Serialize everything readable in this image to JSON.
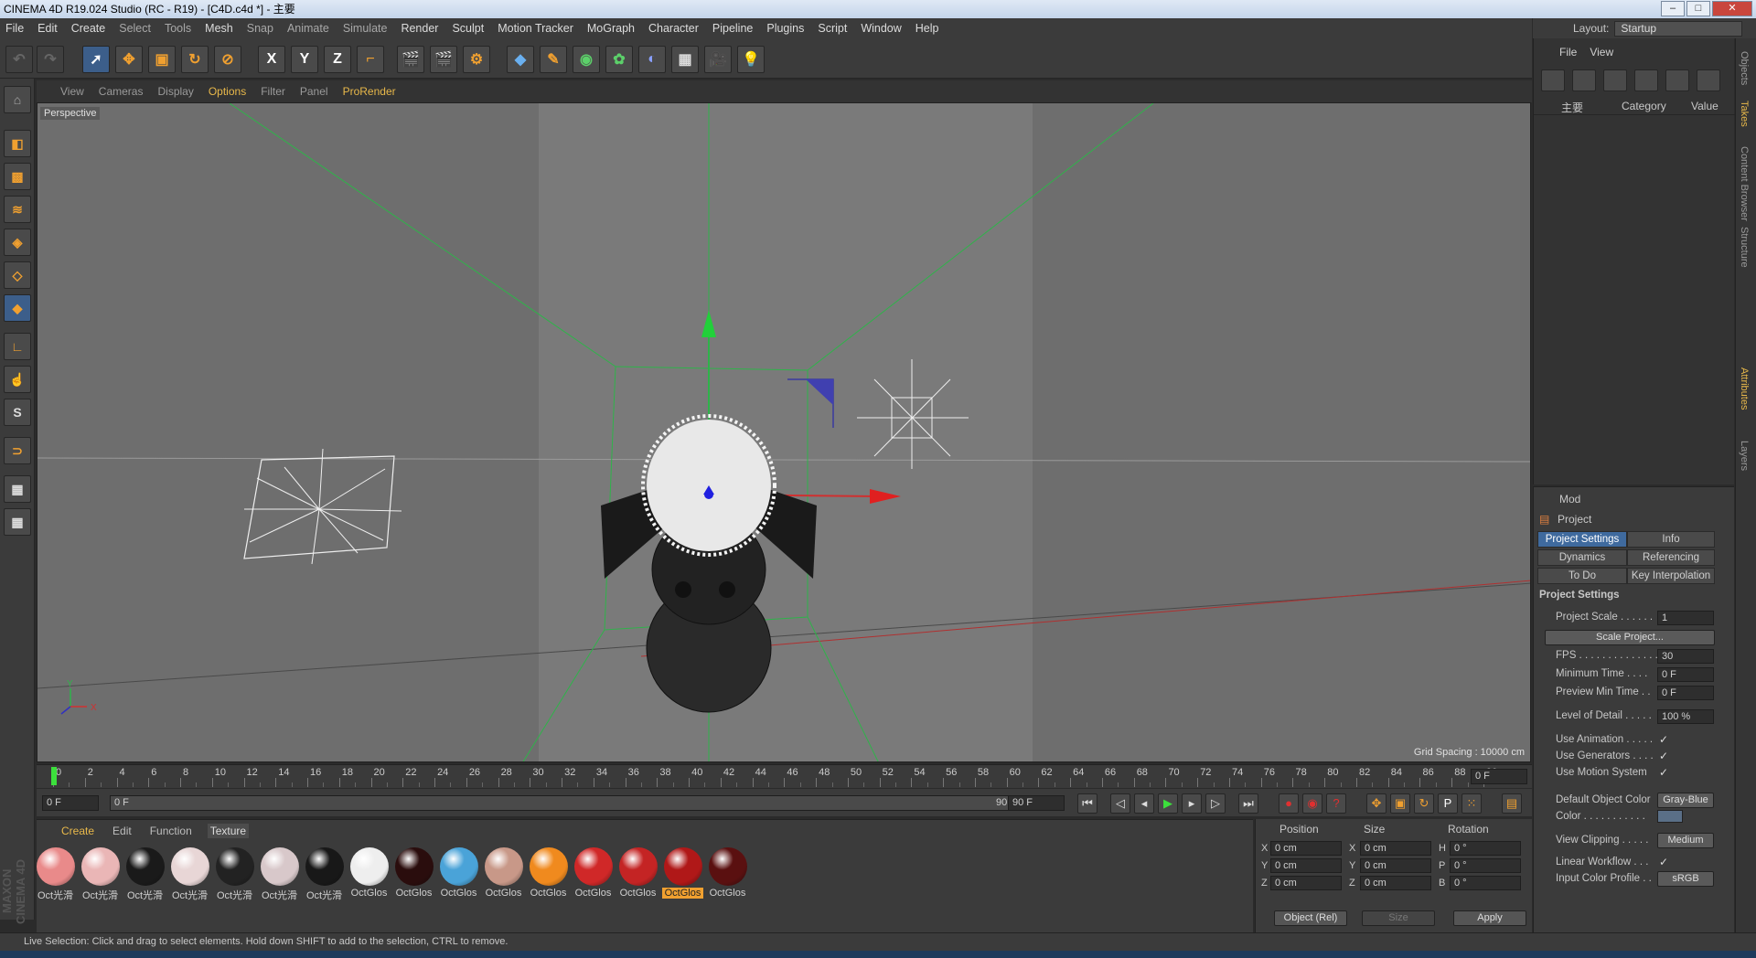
{
  "window": {
    "title": "CINEMA 4D R19.024 Studio (RC - R19) - [C4D.c4d *] - 主要"
  },
  "menubar": {
    "items": [
      "File",
      "Edit",
      "Create",
      "Select",
      "Tools",
      "Mesh",
      "Snap",
      "Animate",
      "Simulate",
      "Render",
      "Sculpt",
      "Motion Tracker",
      "MoGraph",
      "Character",
      "Pipeline",
      "Plugins",
      "Script",
      "Window",
      "Help"
    ]
  },
  "layout": {
    "label": "Layout:",
    "value": "Startup"
  },
  "viewport": {
    "menu": [
      "View",
      "Cameras",
      "Display",
      "Options",
      "Filter",
      "Panel",
      "ProRender"
    ],
    "camera_label": "Perspective",
    "grid_spacing": "Grid Spacing : 10000 cm",
    "axis_y": "Y",
    "axis_x": "X"
  },
  "timeline": {
    "ticks": [
      "0",
      "2",
      "4",
      "6",
      "8",
      "10",
      "12",
      "14",
      "16",
      "18",
      "20",
      "22",
      "24",
      "26",
      "28",
      "30",
      "32",
      "34",
      "36",
      "38",
      "40",
      "42",
      "44",
      "46",
      "48",
      "50",
      "52",
      "54",
      "56",
      "58",
      "60",
      "62",
      "64",
      "66",
      "68",
      "70",
      "72",
      "74",
      "76",
      "78",
      "80",
      "82",
      "84",
      "86",
      "88",
      "90"
    ],
    "current_frame": "0 F",
    "start": "0 F",
    "range_start": "0 F",
    "range_end": "90 F",
    "end": "90 F"
  },
  "materials": {
    "tabs": [
      "Create",
      "Edit",
      "Function",
      "Texture"
    ],
    "items": [
      {
        "label": "Oct光滑",
        "color": "#e98a8a"
      },
      {
        "label": "Oct光滑",
        "color": "#eab6b6"
      },
      {
        "label": "Oct光滑",
        "color": "#1a1a1a"
      },
      {
        "label": "Oct光滑",
        "color": "#e8d6d6"
      },
      {
        "label": "Oct光滑",
        "color": "#222222"
      },
      {
        "label": "Oct光滑",
        "color": "#d8c8ca"
      },
      {
        "label": "Oct光滑",
        "color": "#181818"
      },
      {
        "label": "OctGlos",
        "color": "#eeeeee"
      },
      {
        "label": "OctGlos",
        "color": "#2a0d0d"
      },
      {
        "label": "OctGlos",
        "color": "#4aa3d8"
      },
      {
        "label": "OctGlos",
        "color": "#c89888"
      },
      {
        "label": "OctGlos",
        "color": "#f08a1e"
      },
      {
        "label": "OctGlos",
        "color": "#d02828"
      },
      {
        "label": "OctGlos",
        "color": "#c42424"
      },
      {
        "label": "OctGlos",
        "color": "#b01818"
      },
      {
        "label": "OctGlos",
        "color": "#5a1010"
      }
    ],
    "selected_index": 14
  },
  "coords": {
    "headers": [
      "Position",
      "Size",
      "Rotation"
    ],
    "rows": [
      {
        "a": "X",
        "p": "0 cm",
        "sa": "X",
        "s": "0 cm",
        "ra": "H",
        "r": "0 °"
      },
      {
        "a": "Y",
        "p": "0 cm",
        "sa": "Y",
        "s": "0 cm",
        "ra": "P",
        "r": "0 °"
      },
      {
        "a": "Z",
        "p": "0 cm",
        "sa": "Z",
        "s": "0 cm",
        "ra": "B",
        "r": "0 °"
      }
    ],
    "mode": "Object (Rel)",
    "size_mode": "Size",
    "apply": "Apply"
  },
  "status": "Live Selection: Click and drag to select elements. Hold down SHIFT to add to the selection, CTRL to remove.",
  "objects": {
    "menu": [
      "File",
      "View"
    ],
    "root": "主要",
    "col_category": "Category",
    "col_value": "Value"
  },
  "attributes": {
    "mode": "Mod",
    "title": "Project",
    "tabs": [
      "Project Settings",
      "Info",
      "Dynamics",
      "Referencing",
      "To Do",
      "Key Interpolation"
    ],
    "section": "Project Settings",
    "rows": [
      {
        "label": "Project Scale . . . . . .",
        "value": "1"
      },
      {
        "label": "FPS . . . . . . . . . . . . . .",
        "value": "30"
      },
      {
        "label": "Minimum Time . . . .",
        "value": "0 F"
      },
      {
        "label": "Preview Min Time . .",
        "value": "0 F"
      },
      {
        "label": "Level of Detail . . . . .",
        "value": "100 %"
      },
      {
        "label": "Use Animation . . . . .",
        "value": "✓"
      },
      {
        "label": "Use Generators . . . .",
        "value": "✓"
      },
      {
        "label": "Use Motion System",
        "value": "✓"
      },
      {
        "label": "Default Object Color",
        "value": "Gray-Blue"
      },
      {
        "label": "Color . . . . . . . . . . .",
        "value": ""
      },
      {
        "label": "View Clipping . . . . .",
        "value": "Medium"
      },
      {
        "label": "Linear Workflow . . .",
        "value": "✓"
      },
      {
        "label": "Input Color Profile . .",
        "value": "sRGB"
      }
    ],
    "scale_button": "Scale Project..."
  },
  "side_tabs": [
    "Objects",
    "Takes",
    "Content Browser",
    "Structure",
    "Attributes",
    "Layers"
  ],
  "brand": "MAXON CINEMA 4D"
}
